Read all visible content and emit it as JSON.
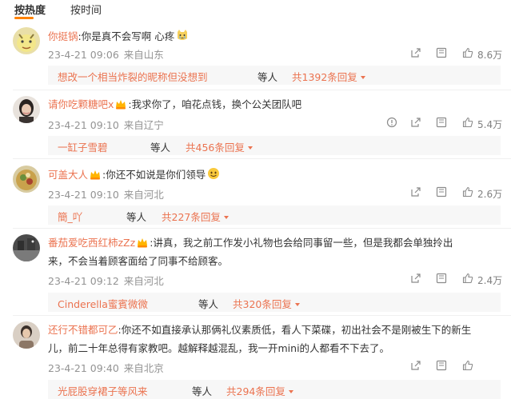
{
  "tabs": [
    {
      "label": "按热度",
      "active": true
    },
    {
      "label": "按时间",
      "active": false
    }
  ],
  "accent_color": "#ff8200",
  "username_color": "#eb7350",
  "comments": [
    {
      "username": "你挺锅",
      "badge": "",
      "text": ":你是真不会写啊 心疼",
      "emoji": "sob-cat-emoji",
      "text2": "",
      "time": "23-4-21 09:06",
      "location": "来自山东",
      "likes": "8.6万",
      "has_report": false,
      "reply_user": "想改一个相当炸裂的昵称但没想到",
      "reply_etc": "等人",
      "reply_count": "共1392条回复"
    },
    {
      "username": "请你吃颗糖吧x",
      "badge": "crown",
      "text": ":我求你了，咱花点钱，换个公关团队吧",
      "emoji": "",
      "text2": "",
      "time": "23-4-21 09:10",
      "location": "来自辽宁",
      "likes": "5.4万",
      "has_report": true,
      "reply_user": "一缸子雪碧",
      "reply_etc": "等人",
      "reply_count": "共456条回复"
    },
    {
      "username": "可盖大人",
      "badge": "crown",
      "text": ":你还不如说是你们领导",
      "emoji": "smile-emoji",
      "text2": "",
      "time": "23-4-21 09:10",
      "location": "来自河北",
      "likes": "2.6万",
      "has_report": false,
      "reply_user": "簡_吖",
      "reply_etc": "等人",
      "reply_count": "共227条回复"
    },
    {
      "username": "番茄爱吃西红柿zZz",
      "badge": "crown",
      "text": ":讲真，我之前工作发小礼物也会给同事留一些，但是我都会单独拎出",
      "emoji": "",
      "text2": "来，不会当着顾客面给了同事不给顾客。",
      "time": "23-4-21 09:12",
      "location": "来自河北",
      "likes": "2.4万",
      "has_report": false,
      "reply_user": "Cinderella蜜賓微微",
      "reply_etc": "等人",
      "reply_count": "共320条回复"
    },
    {
      "username": "还行不错都可乙",
      "badge": "",
      "text": ":你还不如直接承认那俩礼仪素质低，看人下菜碟，初出社会不是刚被生下的新生",
      "emoji": "",
      "text2": "儿，前二十年总得有家教吧。越解释越混乱，我一开mini的人都看不下去了。",
      "time": "23-4-21 09:40",
      "location": "来自北京",
      "likes": "",
      "has_report": false,
      "reply_user": "光屁股穿裙子等风来",
      "reply_etc": "等人",
      "reply_count": "共294条回复"
    }
  ]
}
